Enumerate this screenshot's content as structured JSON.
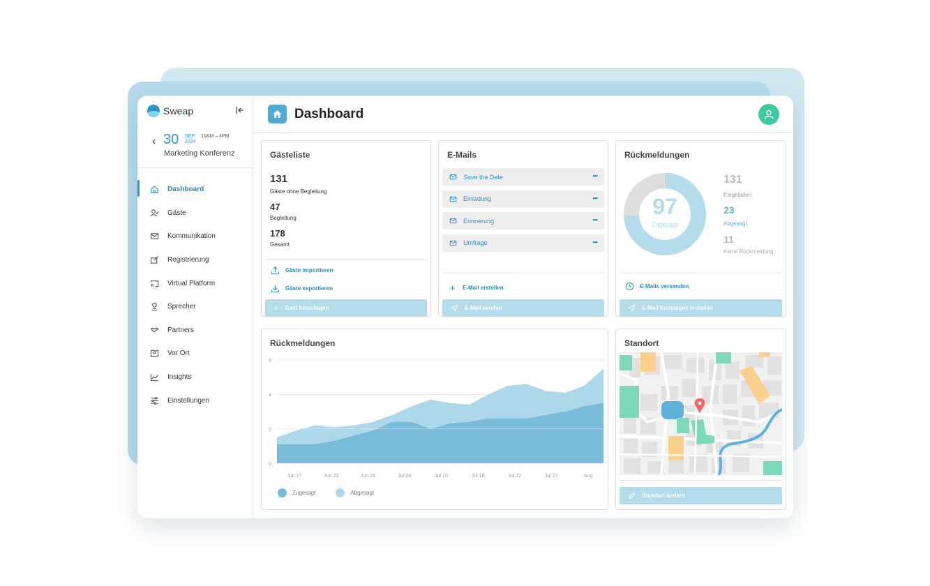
{
  "app": {
    "brand": "Sweap",
    "page_title": "Dashboard"
  },
  "event": {
    "day": "30",
    "month": "SEP",
    "year": "2024",
    "time": "10AM – 4PM",
    "name": "Marketing Konferenz"
  },
  "sidebar": {
    "items": [
      {
        "label": "Dashboard",
        "icon": "home-icon"
      },
      {
        "label": "Gäste",
        "icon": "user-check-icon"
      },
      {
        "label": "Kommunikation",
        "icon": "mail-icon"
      },
      {
        "label": "Registrierung",
        "icon": "form-edit-icon"
      },
      {
        "label": "Virtual Platform",
        "icon": "cast-icon"
      },
      {
        "label": "Sprecher",
        "icon": "speaker-icon"
      },
      {
        "label": "Partners",
        "icon": "handshake-icon"
      },
      {
        "label": "Vor Ort",
        "icon": "map-icon"
      },
      {
        "label": "Insights",
        "icon": "line-chart-icon"
      },
      {
        "label": "Einstellungen",
        "icon": "sliders-icon"
      }
    ]
  },
  "guests": {
    "title": "Gästeliste",
    "stats": [
      {
        "value": "131",
        "label": "Gäste ohne Begleitung"
      },
      {
        "value": "47",
        "label": "Begleitung"
      },
      {
        "value": "178",
        "label": "Gesamt"
      }
    ],
    "import_label": "Gäste importieren",
    "export_label": "Gäste exportieren",
    "add_label": "Gast hinzufügen"
  },
  "emails": {
    "title": "E-Mails",
    "items": [
      "Save the Date",
      "Einladung",
      "Erinnerung",
      "Umfrage"
    ],
    "create_label": "E-Mail erstellen",
    "send_label": "E-Mail senden"
  },
  "responses": {
    "title": "Rückmeldungen",
    "accepted": "97",
    "accepted_label": "Zugesagt",
    "invited": "131",
    "invited_label": "Eingeladen",
    "declined": "23",
    "declined_label": "Abgesagt",
    "no_response": "11",
    "no_response_label": "Keine Rückmeldung",
    "send_emails_label": "E-Mails versenden",
    "campaign_label": "E-Mail Kampagne erstellen",
    "colors": {
      "accepted": "#b5dceb",
      "declined": "#7edcbb",
      "none": "#dedede"
    }
  },
  "chart_card": {
    "title": "Rückmeldungen"
  },
  "chart_data": {
    "type": "area",
    "title": "Rückmeldungen",
    "xlabel": "",
    "ylabel": "",
    "x": [
      "Jun 14",
      "Jun 17",
      "Jun 20",
      "Jun 23",
      "Jun 26",
      "Jun 29",
      "Jul 02",
      "Jul 05",
      "Jul 08",
      "Jul 11",
      "Jul 14",
      "Jul 17",
      "Jul 20",
      "Jul 23",
      "Jul 26",
      "Jul 29",
      "Aug 01",
      "Aug 04"
    ],
    "x_tick_labels": [
      "Jun 17",
      "Jun 23",
      "Jun 29",
      "Jul 04",
      "Jul 10",
      "Jul 16",
      "Jul 22",
      "Jul 27",
      "Aug"
    ],
    "ylim": [
      0,
      6
    ],
    "y_ticks": [
      0,
      2,
      4,
      6
    ],
    "grid": true,
    "legend_position": "bottom-left",
    "series": [
      {
        "name": "Abgesagt",
        "color": "#add8e9",
        "values": [
          1.5,
          1.9,
          2.2,
          2.1,
          2.2,
          2.4,
          2.8,
          3.3,
          3.7,
          3.5,
          3.4,
          4.0,
          4.5,
          4.6,
          4.2,
          4.1,
          4.5,
          5.5
        ]
      },
      {
        "name": "Zugesagt",
        "color": "#78bcd9",
        "values": [
          1.1,
          1.1,
          1.1,
          1.3,
          1.6,
          1.9,
          2.4,
          2.4,
          2.0,
          2.3,
          2.4,
          2.6,
          2.6,
          2.6,
          2.8,
          3.0,
          3.3,
          3.5
        ]
      }
    ]
  },
  "location": {
    "title": "Standort",
    "change_label": "Standort ändern"
  }
}
